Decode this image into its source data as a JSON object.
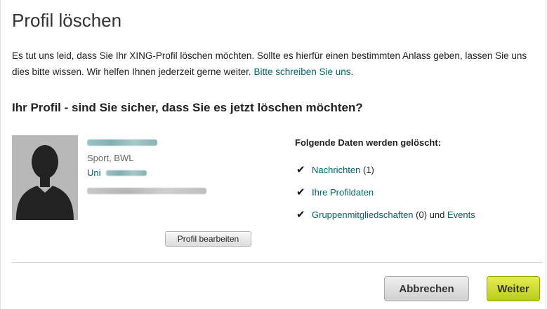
{
  "dialog": {
    "title": "Profil löschen",
    "intro_text": "Es tut uns leid, dass Sie Ihr XING-Profil löschen möchten. Sollte es hierfür einen bestimmten Anlass geben, lassen Sie uns dies bitte wissen. Wir helfen Ihnen jederzeit gerne weiter. ",
    "intro_link": "Bitte schreiben Sie uns",
    "intro_end": ".",
    "question": "Ihr Profil - sind Sie sicher, dass Sie es jetzt löschen möchten?"
  },
  "profile": {
    "field": "Sport, BWL",
    "uni_prefix": "Uni",
    "edit_button": "Profil bearbeiten"
  },
  "deletion": {
    "title": "Folgende Daten werden gelöscht:",
    "items": [
      {
        "link": "Nachrichten",
        "suffix": " (1)"
      },
      {
        "link": "Ihre Profildaten",
        "suffix": ""
      },
      {
        "link": "Gruppenmitgliedschaften",
        "suffix": " (0) und ",
        "link2": "Events"
      }
    ]
  },
  "actions": {
    "cancel": "Abbrechen",
    "continue": "Weiter"
  },
  "icons": {
    "check": "checkmark-icon"
  },
  "colors": {
    "link": "#006567",
    "primary_button": "#c4d52a"
  }
}
